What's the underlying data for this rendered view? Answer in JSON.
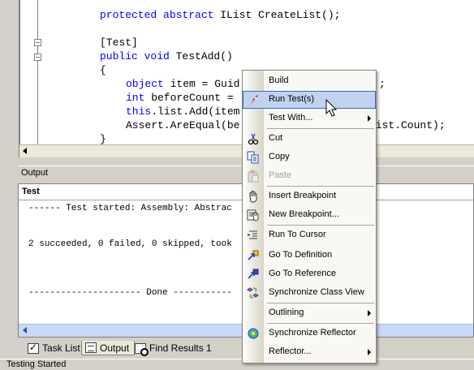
{
  "editor": {
    "lines": [
      {
        "kw": "protected abstract",
        "rest": " IList CreateList();"
      },
      {
        "kw": "",
        "rest": ""
      },
      {
        "kw": "",
        "rest": "[Test]"
      },
      {
        "kw": "public void",
        "rest": " TestAdd()"
      },
      {
        "kw": "",
        "rest": "{"
      },
      {
        "kw": "object",
        "rest": " item = Guid"
      },
      {
        "kw": "int",
        "rest": " beforeCount = "
      },
      {
        "kw": "this",
        "rest": ".list.Add(item"
      },
      {
        "kw": "",
        "rest": "Assert.AreEqual(be"
      },
      {
        "kw": "",
        "rest": "}"
      }
    ],
    "right_fragments": [
      {
        "text": ";"
      },
      {
        "text": "list.Count);"
      }
    ]
  },
  "output": {
    "header": "Output",
    "selected": "Test",
    "lines": [
      "------ Test started: Assembly: Abstrac",
      "",
      "2 succeeded, 0 failed, 0 skipped, took",
      "",
      "",
      "--------------------- Done -----------"
    ]
  },
  "tabs": [
    {
      "label": "Task List",
      "icon": "task-list-icon"
    },
    {
      "label": "Output",
      "icon": "output-icon"
    },
    {
      "label": "Find Results 1",
      "icon": "find-results-icon"
    }
  ],
  "status": {
    "text": "Testing Started"
  },
  "menu": {
    "items": [
      {
        "label": "Build",
        "icon": "",
        "submenu": false,
        "disabled": false
      },
      {
        "label": "Run Test(s)",
        "icon": "rocket-icon",
        "submenu": false,
        "disabled": false,
        "hover": true
      },
      {
        "label": "Test With...",
        "icon": "",
        "submenu": true,
        "disabled": false
      },
      {
        "label": "Cut",
        "icon": "scissors-icon",
        "submenu": false,
        "disabled": false
      },
      {
        "label": "Copy",
        "icon": "copy-icon",
        "submenu": false,
        "disabled": false
      },
      {
        "label": "Paste",
        "icon": "paste-icon",
        "submenu": false,
        "disabled": true
      },
      {
        "label": "Insert Breakpoint",
        "icon": "hand-icon",
        "submenu": false,
        "disabled": false
      },
      {
        "label": "New Breakpoint...",
        "icon": "new-breakpoint-icon",
        "submenu": false,
        "disabled": false
      },
      {
        "label": "Run To Cursor",
        "icon": "run-to-cursor-icon",
        "submenu": false,
        "disabled": false
      },
      {
        "label": "Go To Definition",
        "icon": "go-to-definition-icon",
        "submenu": false,
        "disabled": false
      },
      {
        "label": "Go To Reference",
        "icon": "go-to-reference-icon",
        "submenu": false,
        "disabled": false
      },
      {
        "label": "Synchronize Class View",
        "icon": "synchronize-class-view-icon",
        "submenu": false,
        "disabled": false
      },
      {
        "label": "Outlining",
        "icon": "",
        "submenu": true,
        "disabled": false
      },
      {
        "label": "Synchronize Reflector",
        "icon": "reflector-icon",
        "submenu": false,
        "disabled": false
      },
      {
        "label": "Reflector...",
        "icon": "",
        "submenu": true,
        "disabled": false
      }
    ]
  },
  "colors": {
    "keyword": "#0000ff",
    "menu_hover_bg": "#c1d2ee",
    "menu_hover_border": "#316ac5",
    "output_scroll": "#c8d8f8"
  }
}
